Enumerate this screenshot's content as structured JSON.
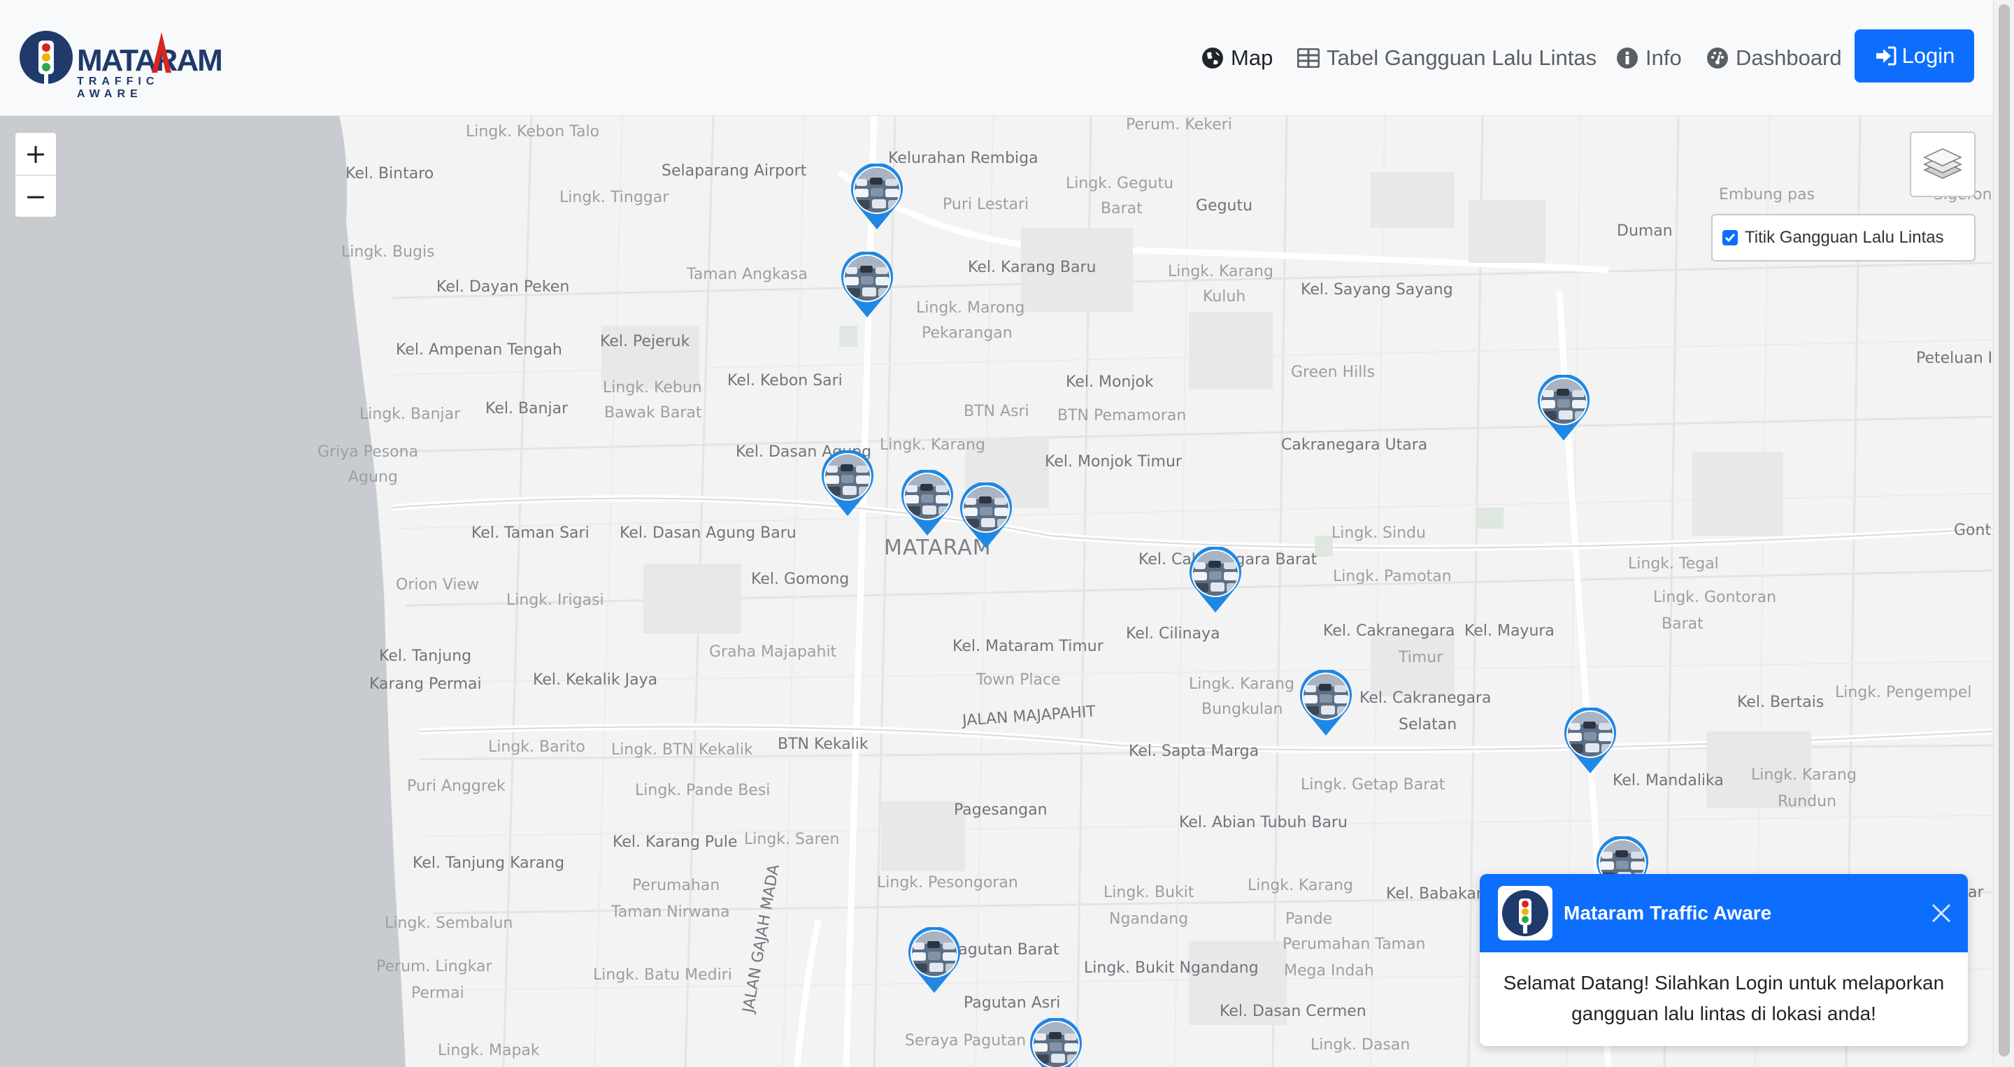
{
  "brand": {
    "word": "MATARAM",
    "sub": "TRAFFIC AWARE",
    "logo": "traffic-light-logo"
  },
  "nav": {
    "map": "Map",
    "table": "Tabel Gangguan Lalu Lintas",
    "info": "Info",
    "dashboard": "Dashboard",
    "login": "Login"
  },
  "map": {
    "zoom_in": "+",
    "zoom_out": "−",
    "layer_label": "Titik Gangguan Lalu Lintas",
    "layer_checked": true,
    "labels": [
      "Lingk. Kebon Talo",
      "Perum. Kekeri",
      "Kel. Bintaro",
      "Selaparang Airport",
      "Kelurahan Rembiga",
      "Lingk. Tinggar",
      "Lingk. Gegutu",
      "Barat",
      "Gegutu",
      "Puri Lestari",
      "Embung pas",
      "Sigerong",
      "Duman",
      "Lingk. Bugis",
      "Taman Angkasa",
      "Kel. Karang Baru",
      "Lingk. Karang",
      "Kuluh",
      "Kel. Sayang Sayang",
      "Kel. Dayan Peken",
      "Lingk. Marong",
      "Pekarangan",
      "Kel. Ampenan Tengah",
      "Kel. Pejeruk",
      "Green Hills",
      "Peteluan I",
      "Kel. Kebon Sari",
      "Lingk. Kebun",
      "Bawak Barat",
      "Kel. Monjok",
      "Lingk. Banjar",
      "Kel. Banjar",
      "BTN Asri",
      "BTN Pemamoran",
      "Griya Pesona",
      "Agung",
      "Kel. Dasan Agung",
      "Lingk. Karang",
      "Kel. Monjok Timur",
      "Cakranegara Utara",
      "MATARAM",
      "Kel. Taman Sari",
      "Kel. Dasan Agung Baru",
      "Lingk. Sindu",
      "Orion View",
      "Kel. Gomong",
      "Lingk. Irigasi",
      "Kel. Cakranegara Barat",
      "Lingk. Pamotan",
      "Lingk. Tegal",
      "Gont",
      "Kel. Cilinaya",
      "Lingk. Gontoran",
      "Barat",
      "Kel. Tanjung",
      "Karang Permai",
      "Graha Majapahit",
      "Kel. Mataram Timur",
      "Kel. Cakranegara",
      "Kel. Mayura",
      "Timur",
      "Kel. Kekalik Jaya",
      "Town Place",
      "Lingk. Karang",
      "Bungkulan",
      "Kel. Cakranegara",
      "Selatan",
      "Kel. Bertais",
      "Lingk. Pengempel",
      "JALAN MAJAPAHIT",
      "Lingk. Barito",
      "Lingk. BTN Kekalik",
      "BTN Kekalik",
      "Kel. Sapta Marga",
      "Puri Anggrek",
      "Lingk. Pande Besi",
      "Lingk. Getap Barat",
      "Kel. Mandalika",
      "Lingk. Karang",
      "Rundun",
      "Pagesangan",
      "Kel. Abian Tubuh Baru",
      "Kel. Karang Pule",
      "Lingk. Saren",
      "Kel. Tanjung Karang",
      "Perumahan",
      "Lingk. Pesongoran",
      "Lingk. Bukit",
      "Lingk. Karang",
      "Kel. Babakan",
      "Taman Nirwana",
      "Ngandang",
      "Pande",
      "Lingk. Sembalun",
      "JALAN GAJAH MADA",
      "Pagutan Barat",
      "Perumahan Taman",
      "Perum. Lingkar",
      "Lingk. Batu Mediri",
      "Lingk. Bukit Ngandang",
      "Mega Indah",
      "Permai",
      "Pagutan Asri",
      "Kel. Dasan Cermen",
      "Lingk. Mapak",
      "Seraya Pagutan",
      "Lingk. Dasan",
      "Kar"
    ]
  },
  "toast": {
    "title": "Mataram Traffic Aware",
    "message_line1": "Selamat Datang! Silahkan Login untuk melaporkan",
    "message_line2": "gangguan lalu lintas di lokasi anda!"
  },
  "colors": {
    "primary": "#0d6efd",
    "brand_navy": "#1f3a6b",
    "brand_red": "#d7261e",
    "map_bg": "#f3f3f3",
    "sea": "#c8ccd0"
  }
}
